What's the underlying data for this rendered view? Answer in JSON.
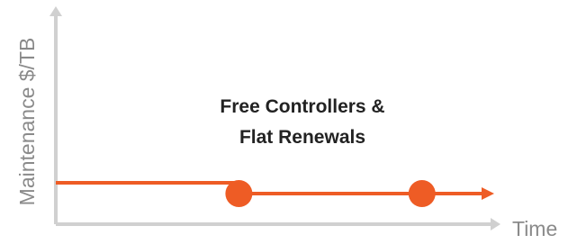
{
  "chart_data": {
    "type": "line",
    "title": "",
    "xlabel": "Time",
    "ylabel": "Maintenance $/TB",
    "annotation": [
      "Free Controllers &",
      "Flat Renewals"
    ],
    "x_ticks": [],
    "y_ticks": [],
    "grid": false,
    "series": [
      {
        "x": [
          0,
          0.43,
          0.86,
          1
        ],
        "y": [
          1,
          0.88,
          0.88,
          0.88
        ],
        "markers_at_index": [
          1,
          2
        ],
        "arrow_end": true
      }
    ],
    "colors": {
      "series": "#EE5C25",
      "axis": "#D0D0D0",
      "axis_label": "#8A8A8A",
      "annotation": "#222222"
    }
  }
}
